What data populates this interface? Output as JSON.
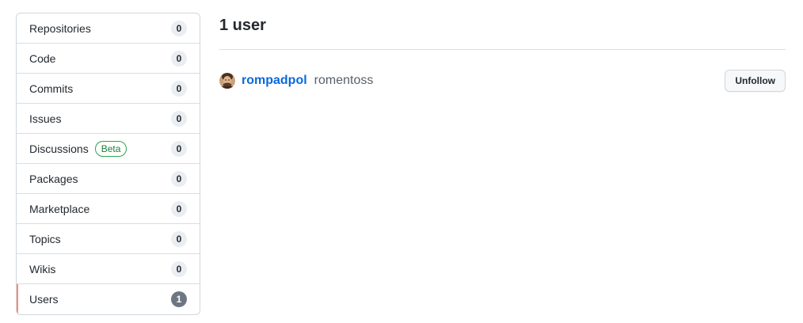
{
  "sidebar": {
    "items": [
      {
        "label": "Repositories",
        "count": "0"
      },
      {
        "label": "Code",
        "count": "0"
      },
      {
        "label": "Commits",
        "count": "0"
      },
      {
        "label": "Issues",
        "count": "0"
      },
      {
        "label": "Discussions",
        "badge": "Beta",
        "count": "0"
      },
      {
        "label": "Packages",
        "count": "0"
      },
      {
        "label": "Marketplace",
        "count": "0"
      },
      {
        "label": "Topics",
        "count": "0"
      },
      {
        "label": "Wikis",
        "count": "0"
      },
      {
        "label": "Users",
        "count": "1",
        "selected": true
      }
    ]
  },
  "results": {
    "heading": "1 user",
    "users": [
      {
        "login": "rompadpol",
        "name": "romentoss",
        "action_label": "Unfollow"
      }
    ]
  },
  "colors": {
    "selected_indicator": "#fd8c73",
    "link": "#0969da",
    "beta_badge": "#1a7f37"
  }
}
